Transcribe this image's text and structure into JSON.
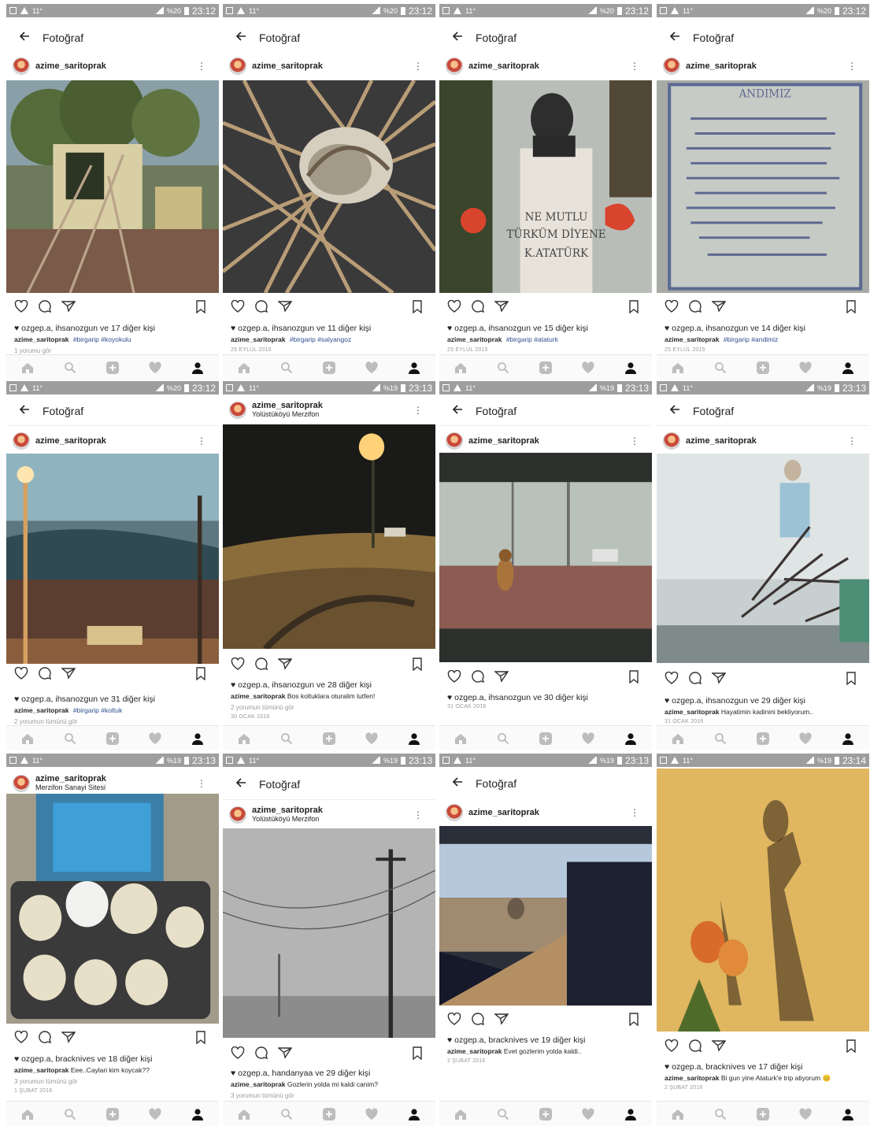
{
  "colors": {
    "statusbar": "#9e9e9e",
    "tag_link": "#2f4f8f",
    "nav_icon": "#bdbdbd",
    "nav_icon_active": "#111111"
  },
  "icon_names": [
    "back-arrow-icon",
    "more-options-icon",
    "heart-icon",
    "comment-icon",
    "share-icon",
    "bookmark-icon",
    "home-icon",
    "search-icon",
    "add-icon",
    "activity-heart-icon",
    "profile-icon"
  ],
  "panels": [
    {
      "status": {
        "time": "23:12",
        "battery": "%20",
        "temp": "11°"
      },
      "appbar": "Fotoğraf",
      "user": "azime_saritoprak",
      "location": "",
      "likes": "ozgep.a, ihsanozgun ve 17 diğer kişi",
      "caption_user": "azime_saritoprak",
      "caption_text": "",
      "tags": "#birgarip #koyokulu",
      "comments": "1 yorumu gör",
      "date": ""
    },
    {
      "status": {
        "time": "23:12",
        "battery": "%20",
        "temp": "11°"
      },
      "appbar": "Fotoğraf",
      "user": "azime_saritoprak",
      "location": "",
      "likes": "ozgep.a, ihsanozgun ve 11 diğer kişi",
      "caption_user": "azime_saritoprak",
      "caption_text": "",
      "tags": "#birgarip #salyangoz",
      "comments": "",
      "date": "25 EYLÜL 2015"
    },
    {
      "status": {
        "time": "23:12",
        "battery": "%20",
        "temp": "11°"
      },
      "appbar": "Fotoğraf",
      "user": "azime_saritoprak",
      "location": "",
      "likes": "ozgep.a, ihsanozgun ve 15 diğer kişi",
      "caption_user": "azime_saritoprak",
      "caption_text": "",
      "tags": "#birgarip #ataturk",
      "comments": "",
      "date": "25 EYLÜL 2015"
    },
    {
      "status": {
        "time": "23:12",
        "battery": "%20",
        "temp": "11°"
      },
      "appbar": "Fotoğraf",
      "user": "azime_saritoprak",
      "location": "",
      "likes": "ozgep.a, ihsanozgun ve 14 diğer kişi",
      "caption_user": "azime_saritoprak",
      "caption_text": "",
      "tags": "#birgarip #andimiz",
      "comments": "",
      "date": "25 EYLÜL 2015"
    },
    {
      "status": {
        "time": "23:12",
        "battery": "%20",
        "temp": "11°"
      },
      "appbar": "Fotoğraf",
      "user": "azime_saritoprak",
      "location": "",
      "likes": "ozgep.a, ihsanozgun ve 31 diğer kişi",
      "caption_user": "azime_saritoprak",
      "caption_text": "",
      "tags": "#birgarip #koltuk",
      "comments": "2 yorumun tümünü gör",
      "date": ""
    },
    {
      "status": {
        "time": "23:13",
        "battery": "%19",
        "temp": "11°"
      },
      "appbar": "",
      "user": "azime_saritoprak",
      "location": "Yolüstüköyü Merzifon",
      "likes": "ozgep.a, ihsanozgun ve 28 diğer kişi",
      "caption_user": "azime_saritoprak",
      "caption_text": "Bos koltuklara oturalim lutfen!",
      "tags": "",
      "comments": "2 yorumun tümünü gör",
      "date": "30 OCAK 2016"
    },
    {
      "status": {
        "time": "23:13",
        "battery": "%19",
        "temp": "11°"
      },
      "appbar": "Fotoğraf",
      "user": "azime_saritoprak",
      "location": "",
      "likes": "ozgep.a, ihsanozgun ve 30 diğer kişi",
      "caption_user": "",
      "caption_text": "",
      "tags": "",
      "comments": "",
      "date": "31 OCAK 2016"
    },
    {
      "status": {
        "time": "23:13",
        "battery": "%19",
        "temp": "11°"
      },
      "appbar": "Fotoğraf",
      "user": "azime_saritoprak",
      "location": "",
      "likes": "ozgep.a, ihsanozgun ve 29 diğer kişi",
      "caption_user": "azime_saritoprak",
      "caption_text": "Hayatimin kadinini bekliyorum..",
      "tags": "",
      "comments": "",
      "date": "31 OCAK 2016"
    },
    {
      "status": {
        "time": "23:13",
        "battery": "%19",
        "temp": "11°"
      },
      "appbar": "",
      "user": "azime_saritoprak",
      "location": "Merzifon Sanayi Sitesi",
      "likes": "ozgep.a, bracknives ve 18 diğer kişi",
      "caption_user": "azime_saritoprak",
      "caption_text": "Eee..Caylari kim koycak??",
      "tags": "",
      "comments": "3 yorumun tümünü gör",
      "date": "1 ŞUBAT 2016"
    },
    {
      "status": {
        "time": "23:13",
        "battery": "%19",
        "temp": "11°"
      },
      "appbar": "Fotoğraf",
      "user": "azime_saritoprak",
      "location": "Yolüstüköyü Merzifon",
      "likes": "ozgep.a, handanyaa ve 29 diğer kişi",
      "caption_user": "azime_saritoprak",
      "caption_text": "Gozlerin yolda mi kaldi canim?",
      "tags": "",
      "comments": "3 yorumun tümünü gör",
      "date": ""
    },
    {
      "status": {
        "time": "23:13",
        "battery": "%19",
        "temp": "11°"
      },
      "appbar": "Fotoğraf",
      "user": "azime_saritoprak",
      "location": "",
      "likes": "ozgep.a, bracknives ve 19 diğer kişi",
      "caption_user": "azime_saritoprak",
      "caption_text": "Evet gozlerim yolda kaldi..",
      "tags": "",
      "comments": "",
      "date": "2 ŞUBAT 2016"
    },
    {
      "status": {
        "time": "23:14",
        "battery": "%19",
        "temp": "11°"
      },
      "appbar": "",
      "user": "",
      "location": "",
      "likes": "ozgep.a, bracknives ve 17 diğer kişi",
      "caption_user": "azime_saritoprak",
      "caption_text": "Bi gun yine Ataturk'e trip atiyorum 😊",
      "tags": "",
      "comments": "",
      "date": "2 ŞUBAT 2016"
    }
  ]
}
